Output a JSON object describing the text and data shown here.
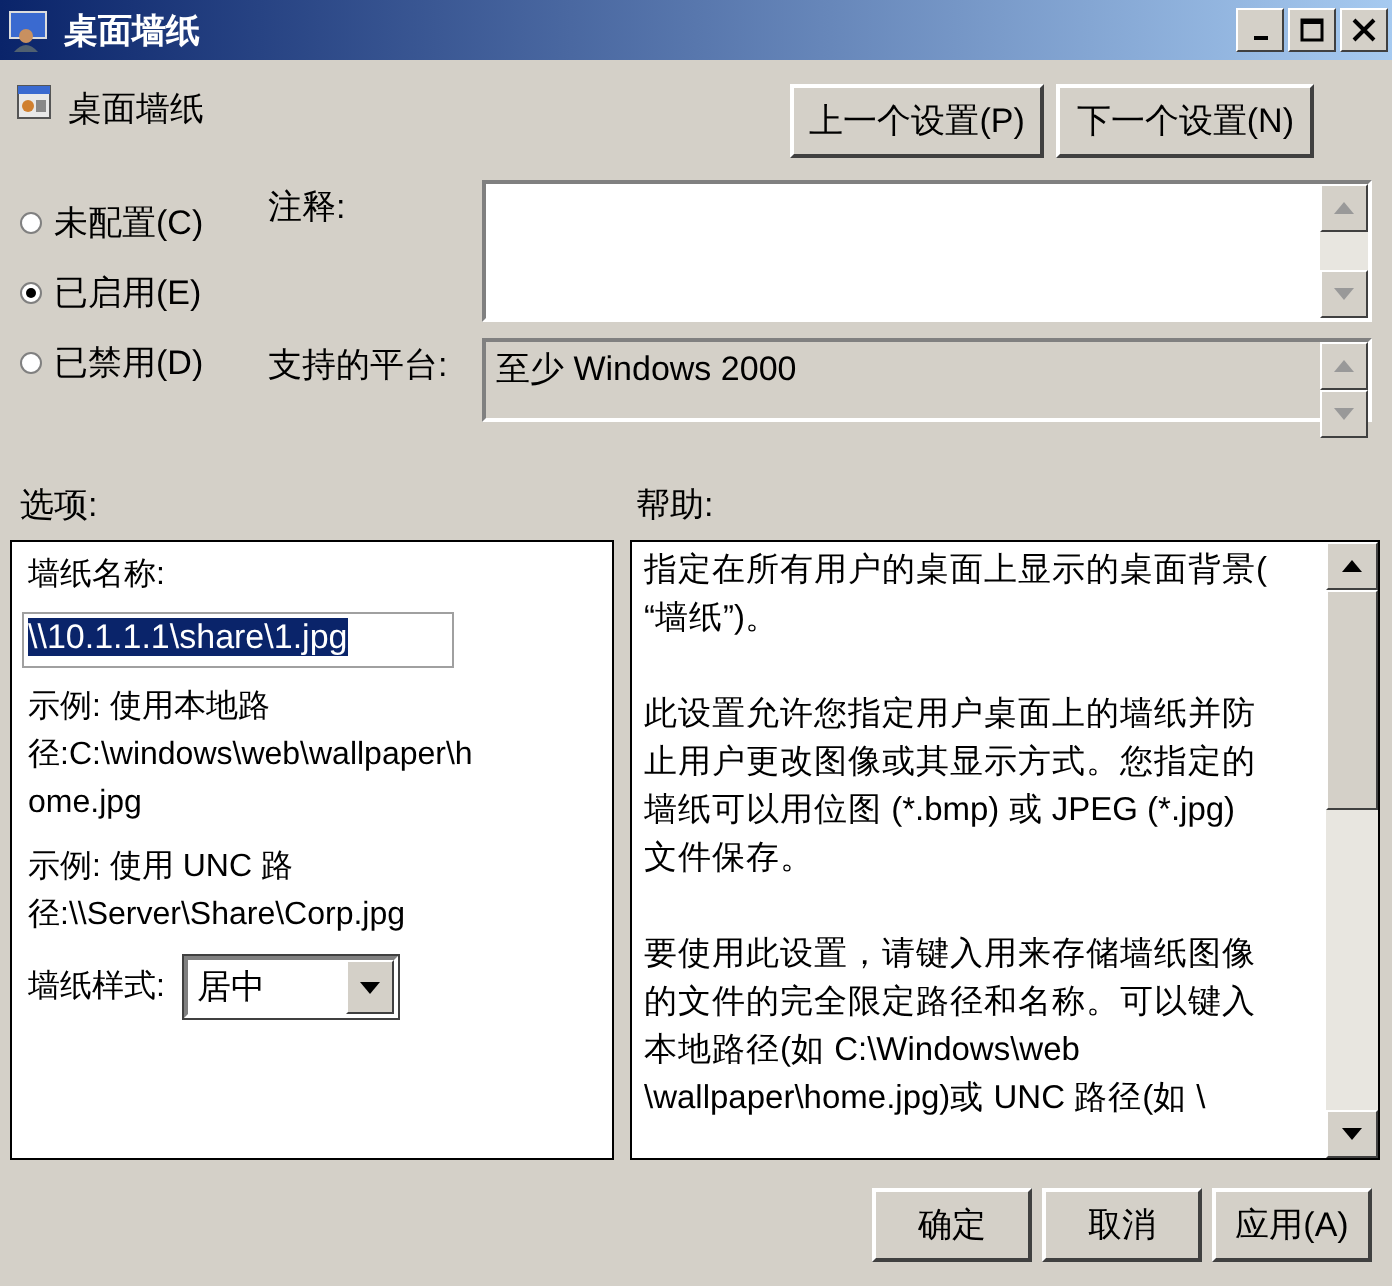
{
  "window": {
    "title": "桌面墙纸"
  },
  "header": {
    "title": "桌面墙纸"
  },
  "nav_buttons": [
    "上一个设置(P)",
    "下一个设置(N)"
  ],
  "state_options": [
    {
      "label": "未配置(C)",
      "selected": false
    },
    {
      "label": "已启用(E)",
      "selected": true
    },
    {
      "label": "已禁用(D)",
      "selected": false
    }
  ],
  "comment": {
    "label": "注释:"
  },
  "platform": {
    "label": "支持的平台:",
    "value": "至少 Windows 2000"
  },
  "options": {
    "label": "选项:",
    "name_label": "墙纸名称:",
    "name_value": "\\\\10.1.1.1\\share\\1.jpg",
    "name_value_selected": true,
    "examples": [
      [
        "示例: 使用本地路",
        "径:C:\\windows\\web\\wallpaper\\h",
        "ome.jpg"
      ],
      [
        "示例: 使用 UNC 路",
        "径:\\\\Server\\Share\\Corp.jpg"
      ]
    ],
    "style_label": "墙纸样式:",
    "style_value": "居中"
  },
  "help": {
    "label": "帮助:",
    "paragraphs": [
      [
        "指定在所有用户的桌面上显示的桌面背景(",
        "“墙纸”)。"
      ],
      [
        "此设置允许您指定用户桌面上的墙纸并防",
        "止用户更改图像或其显示方式。您指定的",
        "墙纸可以用位图 (*.bmp) 或 JPEG (*.jpg)",
        "文件保存。"
      ],
      [
        "要使用此设置，请键入用来存储墙纸图像",
        "的文件的完全限定路径和名称。可以键入",
        "本地路径(如 C:\\Windows\\web",
        "\\wallpaper\\home.jpg)或 UNC 路径(如 \\"
      ]
    ]
  },
  "buttons": [
    "确定",
    "取消",
    "应用(A)"
  ]
}
